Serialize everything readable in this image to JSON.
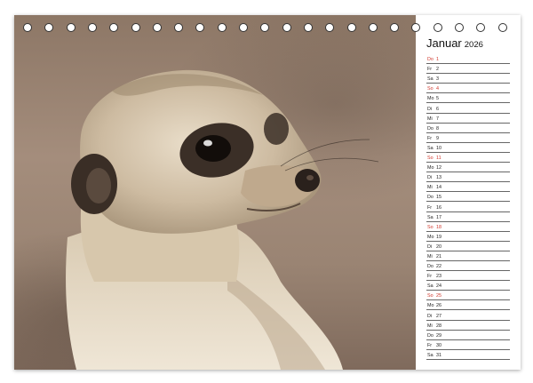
{
  "calendar": {
    "month": "Januar",
    "year": "2026",
    "sunday_color": "#d0372c",
    "days": [
      {
        "dn": "Do",
        "num": "1",
        "sun": true
      },
      {
        "dn": "Fr",
        "num": "2",
        "sun": false
      },
      {
        "dn": "Sa",
        "num": "3",
        "sun": false
      },
      {
        "dn": "So",
        "num": "4",
        "sun": true
      },
      {
        "dn": "Mo",
        "num": "5",
        "sun": false
      },
      {
        "dn": "Di",
        "num": "6",
        "sun": false
      },
      {
        "dn": "Mi",
        "num": "7",
        "sun": false
      },
      {
        "dn": "Do",
        "num": "8",
        "sun": false
      },
      {
        "dn": "Fr",
        "num": "9",
        "sun": false
      },
      {
        "dn": "Sa",
        "num": "10",
        "sun": false
      },
      {
        "dn": "So",
        "num": "11",
        "sun": true
      },
      {
        "dn": "Mo",
        "num": "12",
        "sun": false
      },
      {
        "dn": "Di",
        "num": "13",
        "sun": false
      },
      {
        "dn": "Mi",
        "num": "14",
        "sun": false
      },
      {
        "dn": "Do",
        "num": "15",
        "sun": false
      },
      {
        "dn": "Fr",
        "num": "16",
        "sun": false
      },
      {
        "dn": "Sa",
        "num": "17",
        "sun": false
      },
      {
        "dn": "So",
        "num": "18",
        "sun": true
      },
      {
        "dn": "Mo",
        "num": "19",
        "sun": false
      },
      {
        "dn": "Di",
        "num": "20",
        "sun": false
      },
      {
        "dn": "Mi",
        "num": "21",
        "sun": false
      },
      {
        "dn": "Do",
        "num": "22",
        "sun": false
      },
      {
        "dn": "Fr",
        "num": "23",
        "sun": false
      },
      {
        "dn": "Sa",
        "num": "24",
        "sun": false
      },
      {
        "dn": "So",
        "num": "25",
        "sun": true
      },
      {
        "dn": "Mo",
        "num": "26",
        "sun": false
      },
      {
        "dn": "Di",
        "num": "27",
        "sun": false
      },
      {
        "dn": "Mi",
        "num": "28",
        "sun": false
      },
      {
        "dn": "Do",
        "num": "29",
        "sun": false
      },
      {
        "dn": "Fr",
        "num": "30",
        "sun": false
      },
      {
        "dn": "Sa",
        "num": "31",
        "sun": false
      }
    ]
  }
}
